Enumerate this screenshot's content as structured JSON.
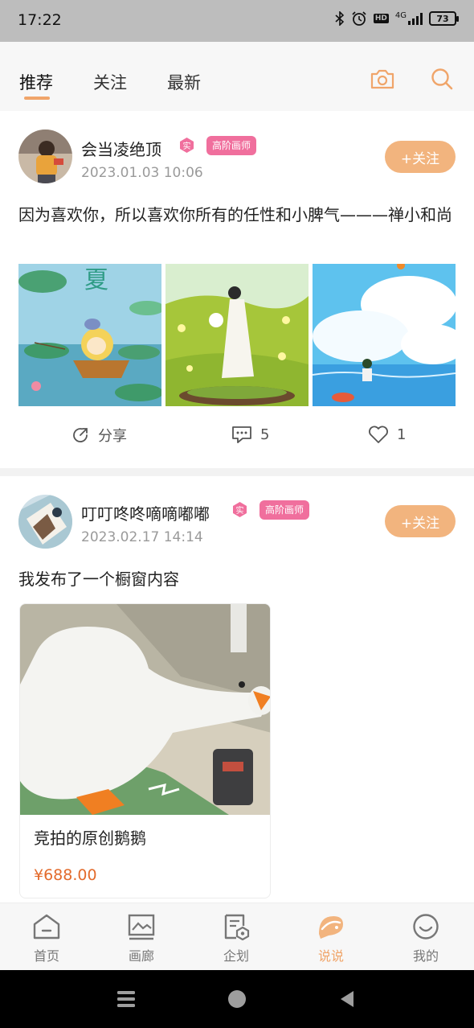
{
  "status_bar": {
    "time": "17:22",
    "network": "4G",
    "hd": "HD",
    "battery": "73",
    "icons": [
      "bluetooth-icon",
      "alarm-icon",
      "hd-icon",
      "signal-icon",
      "battery-icon"
    ]
  },
  "top_nav": {
    "tabs": [
      {
        "label": "推荐",
        "active": true
      },
      {
        "label": "关注",
        "active": false
      },
      {
        "label": "最新",
        "active": false
      }
    ],
    "actions": [
      "camera-icon",
      "search-icon"
    ],
    "accent_color": "#f0a56a"
  },
  "posts": [
    {
      "username": "会当凌绝顶",
      "verified_badge": "实",
      "level_badge": "高阶画师",
      "time": "2023.01.03 10:06",
      "follow_label": "+关注",
      "text": "因为喜欢你，所以喜欢你所有的任性和小脾气———禅小和尚",
      "images": [
        "boy-fishing-summer-illustration",
        "girl-white-dress-flowers-illustration",
        "boy-seaside-clouds-illustration"
      ],
      "image_caption": "夏",
      "actions": {
        "share_label": "分享",
        "comment_count": "5",
        "like_count": "1"
      }
    },
    {
      "username": "叮叮咚咚嘀嘀嘟嘟",
      "verified_badge": "实",
      "level_badge": "高阶画师",
      "time": "2023.02.17 14:14",
      "follow_label": "+关注",
      "text": "我发布了一个橱窗内容",
      "product": {
        "title": "竞拍的原创鹅鹅",
        "price": "¥688.00",
        "image": "white-goose-illustration"
      }
    }
  ],
  "bottom_nav": {
    "tabs": [
      {
        "label": "首页",
        "icon": "home-icon",
        "active": false
      },
      {
        "label": "画廊",
        "icon": "gallery-icon",
        "active": false
      },
      {
        "label": "企划",
        "icon": "plan-icon",
        "active": false
      },
      {
        "label": "说说",
        "icon": "talk-icon",
        "active": true
      },
      {
        "label": "我的",
        "icon": "profile-icon",
        "active": false
      }
    ]
  },
  "colors": {
    "follow_button": "#f2b47e",
    "level_badge": "#f06f9d",
    "price": "#e36b2c",
    "status_bar": "#bdbdbd"
  }
}
